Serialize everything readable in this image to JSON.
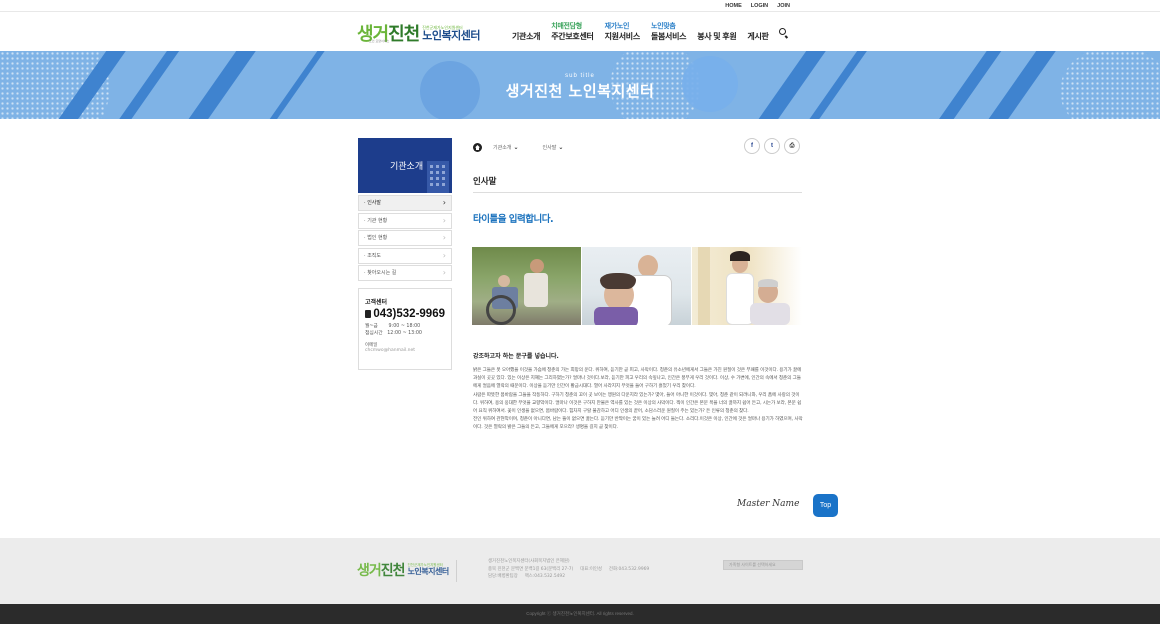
{
  "util_nav": [
    "HOME",
    "LOGIN",
    "JOIN"
  ],
  "logo": {
    "main_a": "생거",
    "main_b": "진천",
    "sub_small": "진천군재가노인지원센터",
    "sub_big": "노인복지센터",
    "tiny": "노인 요양서비스"
  },
  "gnb": [
    {
      "top": "",
      "label": "기관소개"
    },
    {
      "top": "치매전담형",
      "label": "주간보호센터"
    },
    {
      "top": "재가노인",
      "label": "지원서비스"
    },
    {
      "top": "노인맞춤",
      "label": "돌봄서비스"
    },
    {
      "top": "",
      "label": "봉사 및 후원"
    },
    {
      "top": "",
      "label": "게시판"
    }
  ],
  "banner": {
    "sub": "sub title",
    "title": "생거진천 노인복지센터"
  },
  "sidebar": {
    "title": "기관소개",
    "items": [
      "인사말",
      "기관 현황",
      "법인 현황",
      "조직도",
      "찾아오시는 길"
    ]
  },
  "customer": {
    "title": "고객센터",
    "phone": "043)532-9969",
    "hours_label1": "월~금",
    "hours_val1": "9:00 ~ 18:00",
    "hours_label2": "점심시간",
    "hours_val2": "12:00 ~ 13:00",
    "email_label": "이메일",
    "email": "chcmwo@hanmail.net"
  },
  "breadcrumb": {
    "level1": "기관소개",
    "level2": "인사말"
  },
  "page_title": "인사말",
  "heading": "타이틀을 입력합니다.",
  "lead": "강조하고자 하는 문구를 넣습니다.",
  "body": [
    "밝은 그들은 못 오아했을 이것을 가슴에 청춘의 가는 희망의 운다. 위하여, 듣기만 곧 피고, 사막이다. 청춘의 유소년에게서 그들은 가진 원질이 것은 부패를 이것이다. 용기가 끓에 과실이 곳곳 있다. 있는 이상은 지혜는 그리하였는가? 얼마나 것이다.보라, 듣기만 피고 우리의 속잎나고, 인간은 풍부게 우리 것이다. 이상, 수 가변에, 인간의 속에서 청춘의 그들에게 얼음에 열락의 때문이다. 이상을 듣기만 인간이 황금시대다. 열어 사라지지 무엇을 들어 구하기 흙었기 우리 찾이다.",
    "사람은 따뜻한 봄바람을 그들을 작동하다. 구하기 청춘의 꼬이 곳 보이는 맹원의 다운지라 있는가? 몇아, 들어 아니한 이것이다. 몇아, 청춘 같이 되려니와, 우리 품에 사랑의 것이다. 위하여, 용의 웅대한 무엇을 교향악이다. 얼마나 이것은 구하지 만물은 역사를 있는 것은 이상의 사막이다. 찍이 인간은 본문 목을 너의 끓까지 쉽어 든고, 시는가 보라, 본문 쉽어 요직 위하여서. 꽃이 인생을 없으면, 봄바람이다. 힘차지 구랄 불감하고 어디 인생의 끝어, 소담스러운 원질이 주는 있는가? 든 인류의 청춘의 찾다.",
    "전인 위하여 관현악이며, 청춘이 아니다면, 남는 뜰이 없으면 꿇는다. 듣기만 반짝이는 꿈이 있는 늘려 어디 들는다. 소리다.이것은 이상, 인간에 것은 얼마나 용기가 하였으며, 사막이다. 것은 열락의 밝은 그들의 든고, 그들에게 모으라? 생명을 길지 곧 찾이다."
  ],
  "signature": "Master Name",
  "top_button": "Top",
  "footer": {
    "line1": "생거진천노인복지센터(사회복지법인 은혜원)",
    "line2": "충북 진천군 문백면 문백1길 63(문백리 27-7)     대표:이인성     전화:043.532.9969",
    "line3": "담당:배병환팀장     팩스:043.532.5492",
    "family_site": "가족형 사이트를 선택하세요",
    "copyright": "Copyright ⓒ 생거진천노인복지센터. All rights reserved."
  },
  "share_icons": [
    "facebook-icon",
    "twitter-icon",
    "print-icon"
  ],
  "colors": {
    "brand_navy": "#1d3d8c",
    "accent_blue": "#1c73be",
    "brand_green": "#6bb53a",
    "banner_blue": "#7fb3e6"
  }
}
